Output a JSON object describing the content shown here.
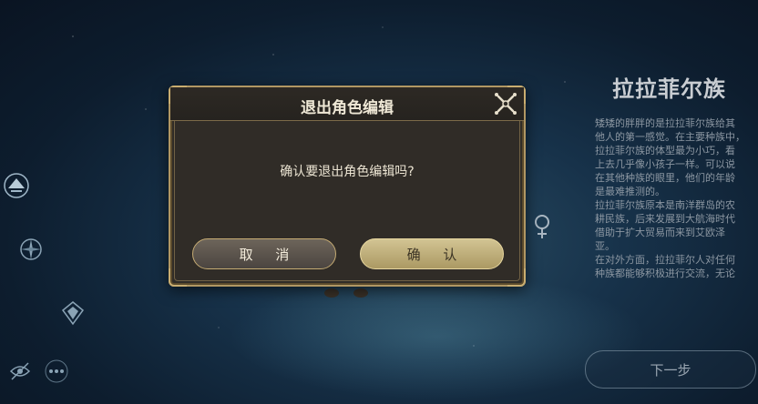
{
  "background": {
    "accent": "#b19763"
  },
  "left_toolbar": {
    "icons": [
      "star-ship-icon",
      "compass-icon",
      "crest-icon",
      "hide-ui-icon",
      "more-icon"
    ]
  },
  "race_panel": {
    "title": "拉拉菲尔族",
    "description": [
      "矮矮的胖胖的是拉拉菲尔族给其",
      "他人的第一感觉。在主要种族中，",
      "拉拉菲尔族的体型最为小巧，看",
      "上去几乎像小孩子一样。可以说",
      "在其他种族的眼里，他们的年龄",
      "是最难推测的。",
      "拉拉菲尔族原本是南洋群岛的农",
      "耕民族，后来发展到大航海时代",
      "借助于扩大贸易而来到艾欧泽",
      "亚。",
      "在对外方面，拉拉菲尔人对任何",
      "种族都能够积极进行交流，无论"
    ],
    "gender_icon": "female-symbol-icon",
    "next_label": "下一步"
  },
  "dialog": {
    "title": "退出角色编辑",
    "message": "确认要退出角色编辑吗?",
    "cancel_label": "取 消",
    "confirm_label": "确 认",
    "close_icon": "close-icon"
  }
}
